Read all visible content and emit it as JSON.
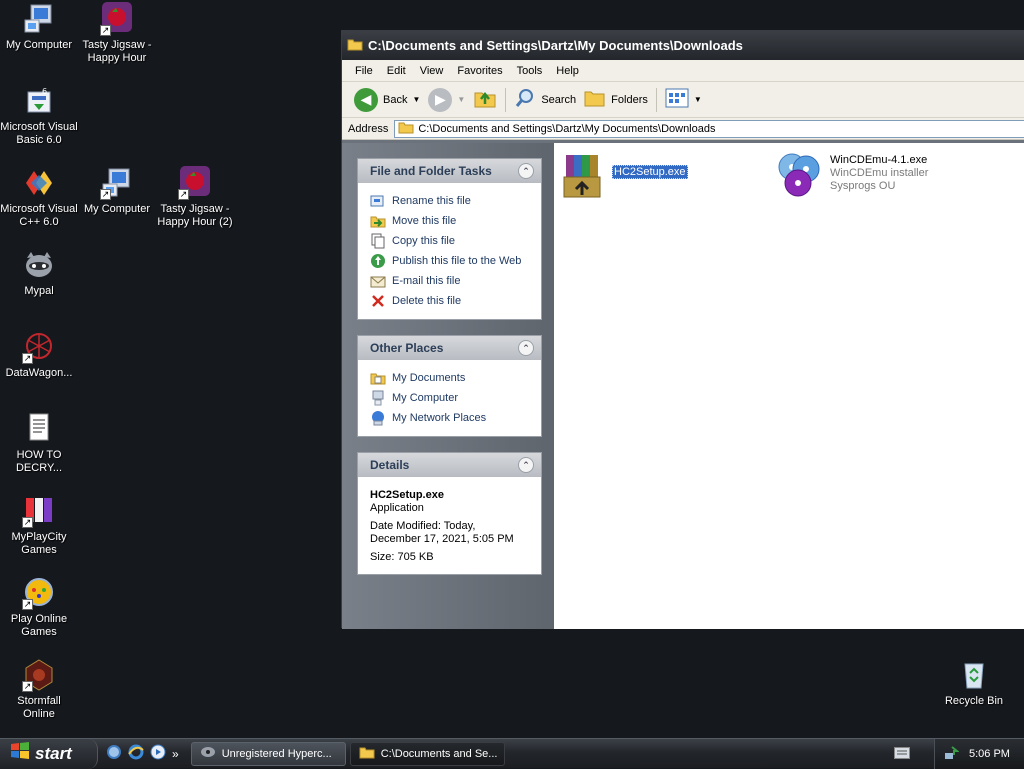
{
  "desktop": {
    "icons": [
      {
        "label": "My Computer"
      },
      {
        "label": "Tasty Jigsaw - Happy Hour"
      },
      {
        "label": "Microsoft Visual Basic 6.0"
      },
      {
        "label": "Microsoft Visual C++ 6.0"
      },
      {
        "label": "My Computer"
      },
      {
        "label": "Tasty Jigsaw - Happy Hour (2)"
      },
      {
        "label": "Mypal"
      },
      {
        "label": "DataWagon..."
      },
      {
        "label": "HOW TO DECRY..."
      },
      {
        "label": "MyPlayCity Games"
      },
      {
        "label": "Play Online Games"
      },
      {
        "label": "Stormfall Online"
      },
      {
        "label": "Recycle Bin"
      }
    ]
  },
  "window": {
    "title": "C:\\Documents and Settings\\Dartz\\My Documents\\Downloads",
    "menu": [
      "File",
      "Edit",
      "View",
      "Favorites",
      "Tools",
      "Help"
    ],
    "toolbar": {
      "back": "Back",
      "search": "Search",
      "folders": "Folders"
    },
    "address": {
      "label": "Address",
      "value": "C:\\Documents and Settings\\Dartz\\My Documents\\Downloads"
    },
    "tasks": {
      "title": "File and Folder Tasks",
      "items": [
        "Rename this file",
        "Move this file",
        "Copy this file",
        "Publish this file to the Web",
        "E-mail this file",
        "Delete this file"
      ]
    },
    "places": {
      "title": "Other Places",
      "items": [
        "My Documents",
        "My Computer",
        "My Network Places"
      ]
    },
    "details": {
      "title": "Details",
      "filename": "HC2Setup.exe",
      "type": "Application",
      "modified": "Date Modified: Today, December 17, 2021, 5:05 PM",
      "size": "Size: 705 KB"
    },
    "files": [
      {
        "name": "HC2Setup.exe",
        "selected": true
      },
      {
        "name": "WinCDEmu-4.1.exe",
        "description": "WinCDEmu installer",
        "company": "Sysprogs OU"
      }
    ]
  },
  "taskbar": {
    "start_label": "start",
    "tasks": [
      "Unregistered Hyperc...",
      "C:\\Documents and Se..."
    ],
    "clock": "5:06 PM"
  },
  "colors": {
    "selection": "#316ac5",
    "taskpane_link": "#1f3a63",
    "desktop_bg": "#15181d"
  }
}
